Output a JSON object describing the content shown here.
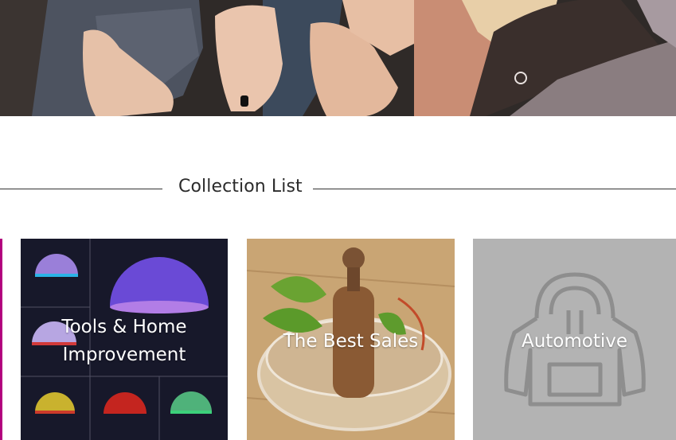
{
  "section": {
    "title": "Collection List"
  },
  "collections": [
    {
      "label": "Tools & Home Improvement"
    },
    {
      "label": "The Best Sales"
    },
    {
      "label": "Automotive"
    }
  ],
  "colors": {
    "accent_edge": "#b2007e",
    "card_gray": "#b3b3b3",
    "text_dark": "#2b2b2b"
  }
}
